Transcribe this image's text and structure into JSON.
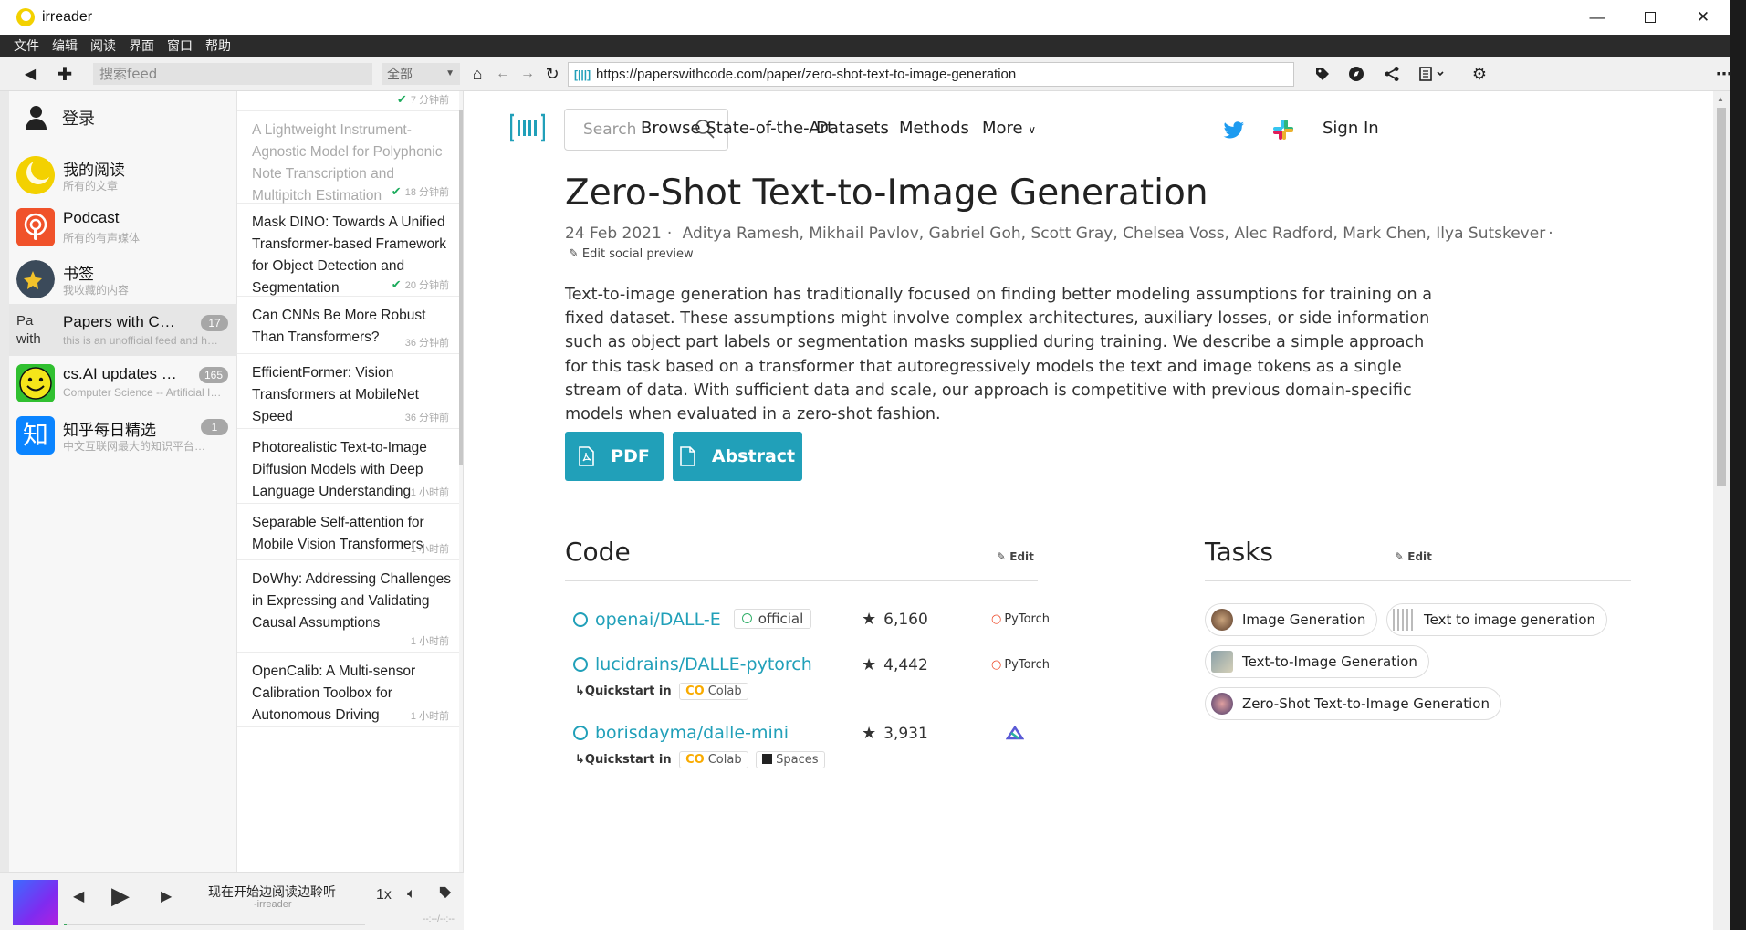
{
  "window": {
    "title": "irreader"
  },
  "menu": [
    "文件",
    "编辑",
    "阅读",
    "界面",
    "窗口",
    "帮助"
  ],
  "toolbar": {
    "search_placeholder": "搜索feed",
    "filter_value": "全部",
    "url": "https://paperswithcode.com/paper/zero-shot-text-to-image-generation"
  },
  "sidebar": {
    "login_label": "登录",
    "feeds": [
      {
        "name": "我的阅读",
        "desc": "所有的文章",
        "badge": "",
        "icon": "moon-icon"
      },
      {
        "name": "Podcast",
        "desc": "所有的有声媒体",
        "badge": "",
        "icon": "podcast-icon"
      },
      {
        "name": "书签",
        "desc": "我收藏的内容",
        "badge": "",
        "icon": "star-icon"
      },
      {
        "name": "Papers with C…",
        "desc": "this is an unofficial feed and h…",
        "badge": "17",
        "icon": "broken-image-icon",
        "icon_alt": "Pa with"
      },
      {
        "name": "cs.AI updates …",
        "desc": "Computer Science -- Artificial I…",
        "badge": "165",
        "icon": "smiley-icon"
      },
      {
        "name": "知乎每日精选",
        "desc": "中文互联网最大的知识平台…",
        "badge": "1",
        "icon": "zhihu-icon",
        "icon_text": "知"
      }
    ]
  },
  "player": {
    "title": "现在开始边阅读边聆听",
    "subtitle": "-irreader",
    "speed": "1x",
    "time": "--:--/--:--",
    "progress": 0.01
  },
  "articles": [
    {
      "title": "",
      "time": "7 分钟前",
      "read": true,
      "checked": true
    },
    {
      "title": "A Lightweight Instrument-Agnostic Model for Polyphonic Note Transcription and Multipitch Estimation",
      "time": "18 分钟前",
      "read": true,
      "checked": true
    },
    {
      "title": "Mask DINO: Towards A Unified Transformer-based Framework for Object Detection and Segmentation",
      "time": "20 分钟前",
      "read": false,
      "checked": true
    },
    {
      "title": "Can CNNs Be More Robust Than Transformers?",
      "time": "36 分钟前",
      "read": false,
      "checked": false
    },
    {
      "title": "EfficientFormer: Vision Transformers at MobileNet Speed",
      "time": "36 分钟前",
      "read": false,
      "checked": false
    },
    {
      "title": "Photorealistic Text-to-Image Diffusion Models with Deep Language Understanding",
      "time": "1 小时前",
      "read": false,
      "checked": false
    },
    {
      "title": "Separable Self-attention for Mobile Vision Transformers",
      "time": "1 小时前",
      "read": false,
      "checked": false
    },
    {
      "title": "DoWhy: Addressing Challenges in Expressing and Validating Causal Assumptions",
      "time": "1 小时前",
      "read": false,
      "checked": false
    },
    {
      "title": "OpenCalib: A Multi-sensor Calibration Toolbox for Autonomous Driving",
      "time": "1 小时前",
      "read": false,
      "checked": false
    },
    {
      "title": "",
      "time": "",
      "read": false,
      "checked": false
    }
  ],
  "web": {
    "search_placeholder": "Search",
    "nav": [
      "Browse State-of-the-Art",
      "Datasets",
      "Methods",
      "More"
    ],
    "sign_in": "Sign In",
    "title": "Zero-Shot Text-to-Image Generation",
    "date": "24 Feb 2021",
    "authors": [
      "Aditya Ramesh,",
      "Mikhail Pavlov,",
      "Gabriel Goh,",
      "Scott Gray,",
      "Chelsea Voss,",
      "Alec Radford,",
      "Mark Chen,",
      "Ilya Sutskever"
    ],
    "edit_social": "Edit social preview",
    "abstract": "Text-to-image generation has traditionally focused on finding better modeling assumptions for training on a fixed dataset. These assumptions might involve complex architectures, auxiliary losses, or side information such as object part labels or segmentation masks supplied during training. We describe a simple approach for this task based on a transformer that autoregressively models the text and image tokens as a single stream of data. With sufficient data and scale, our approach is competitive with previous domain-specific models when evaluated in a zero-shot fashion.",
    "btn_pdf": "PDF",
    "btn_abstract": "Abstract",
    "code_heading": "Code",
    "tasks_heading": "Tasks",
    "edit": "Edit",
    "repos": [
      {
        "name": "openai/DALL-E",
        "official": "official",
        "stars": "6,160",
        "framework": "PyTorch",
        "quickstart": ""
      },
      {
        "name": "lucidrains/DALLE-pytorch",
        "official": "",
        "stars": "4,442",
        "framework": "PyTorch",
        "quickstart": "Quickstart in",
        "pills": [
          "Colab"
        ]
      },
      {
        "name": "borisdayma/dalle-mini",
        "official": "",
        "stars": "3,931",
        "framework": "jax-icon",
        "quickstart": "Quickstart in",
        "pills": [
          "Colab",
          "Spaces"
        ]
      }
    ],
    "tasks": [
      "Image Generation",
      "Text to image generation",
      "Text-to-Image Generation",
      "Zero-Shot Text-to-Image Generation"
    ],
    "colors": {
      "accent": "#21a0b9",
      "twitter": "#1d9bf0"
    }
  }
}
